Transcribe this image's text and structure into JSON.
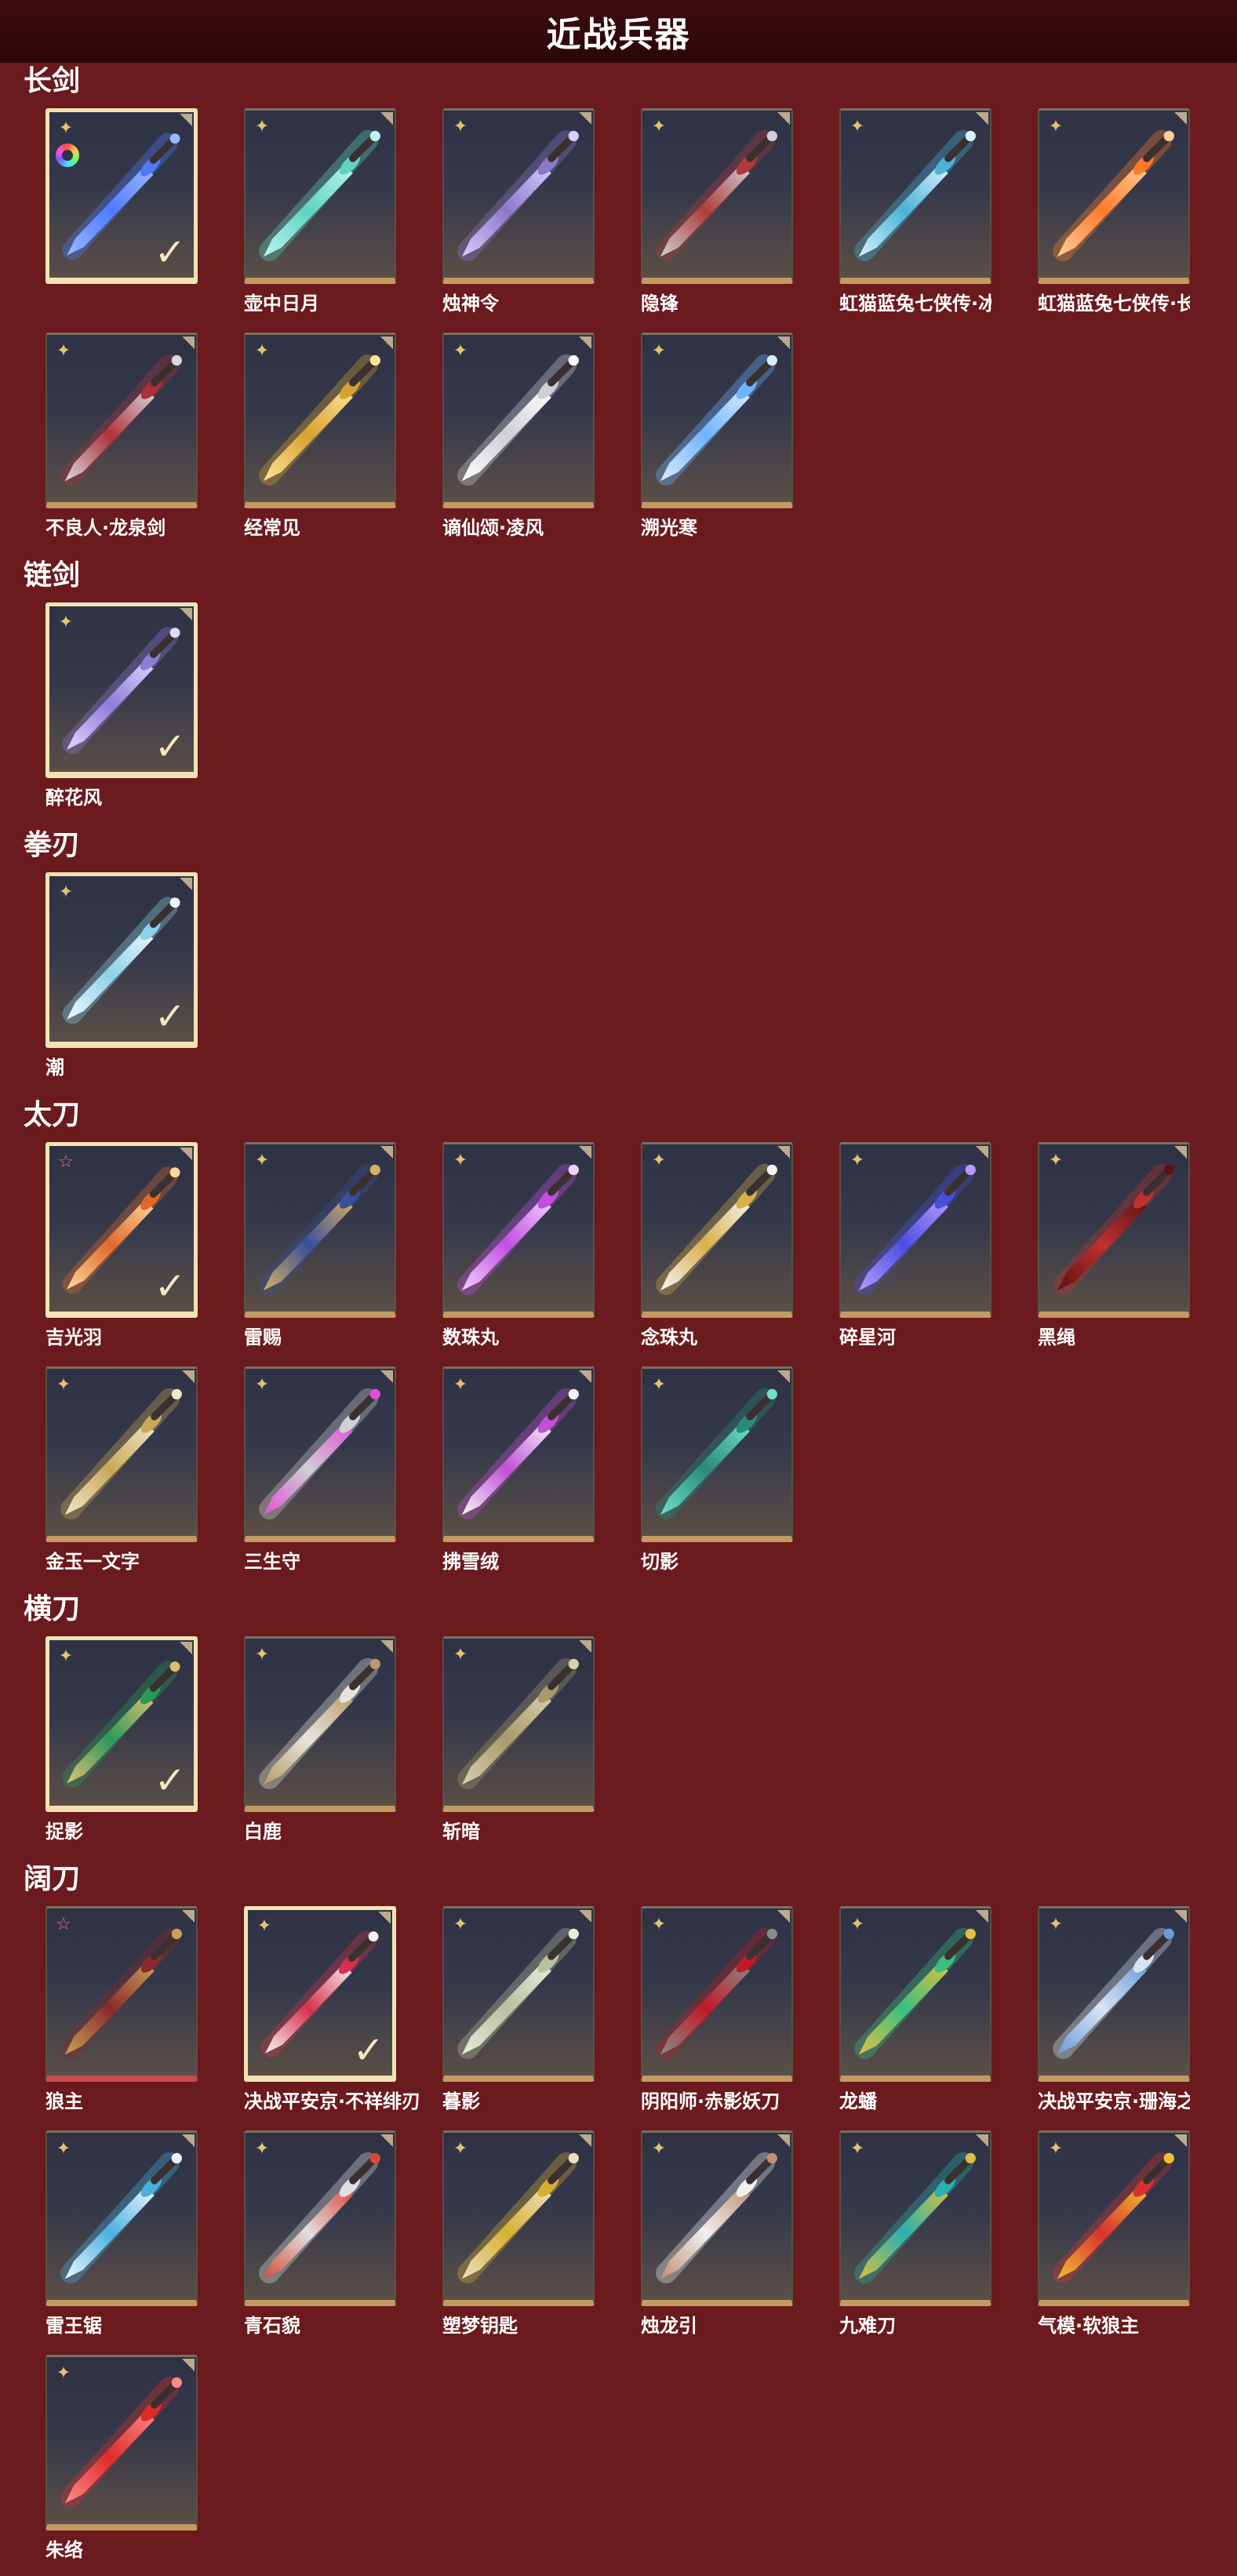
{
  "page": {
    "title": "近战兵器"
  },
  "sections": [
    {
      "title": "长剑",
      "items": [
        {
          "name": "",
          "badge": "gold",
          "dye": true,
          "owned": true,
          "color": "#4f7bff",
          "glow": "#9ab8ff"
        },
        {
          "name": "壶中日月",
          "badge": "gold",
          "color": "#5fd3c2",
          "glow": "#b8f5ec"
        },
        {
          "name": "烛神令",
          "badge": "gold",
          "color": "#8b78c9",
          "glow": "#d8ccff"
        },
        {
          "name": "隐锋",
          "badge": "gold",
          "color": "#b03a3a",
          "glow": "#cfcfd8"
        },
        {
          "name": "虹猫蓝兔七侠传·冰魄剑",
          "badge": "gold",
          "color": "#4bb3d6",
          "glow": "#d6f3ff"
        },
        {
          "name": "虹猫蓝兔七侠传·长虹剑",
          "badge": "gold",
          "color": "#ff7a2a",
          "glow": "#ffd09a"
        },
        {
          "name": "不良人·龙泉剑",
          "badge": "gold",
          "color": "#b0303a",
          "glow": "#d8d8e0"
        },
        {
          "name": "经常见",
          "badge": "gold",
          "color": "#d6a230",
          "glow": "#ffe39a"
        },
        {
          "name": "谪仙颂·凌风",
          "badge": "gold",
          "color": "#cfcfd4",
          "glow": "#ffffff"
        },
        {
          "name": "溯光寒",
          "badge": "gold",
          "color": "#6fb3ff",
          "glow": "#d9ecff"
        }
      ]
    },
    {
      "title": "链剑",
      "items": [
        {
          "name": "醉花风",
          "badge": "gold",
          "owned": true,
          "color": "#8f7bd8",
          "glow": "#e0d6ff"
        }
      ]
    },
    {
      "title": "拳刃",
      "items": [
        {
          "name": "潮",
          "badge": "gold",
          "owned": true,
          "color": "#8fd0e8",
          "glow": "#eef8ff"
        }
      ]
    },
    {
      "title": "太刀",
      "items": [
        {
          "name": "吉光羽",
          "badge": "pink",
          "owned": true,
          "color": "#e0692a",
          "glow": "#ffd6a0"
        },
        {
          "name": "雷赐",
          "badge": "gold",
          "color": "#3a4f9a",
          "glow": "#d6b060"
        },
        {
          "name": "数珠丸",
          "badge": "gold",
          "color": "#c24fe0",
          "glow": "#f0d0ff"
        },
        {
          "name": "念珠丸",
          "badge": "gold",
          "color": "#d8b04a",
          "glow": "#f4f4f4"
        },
        {
          "name": "碎星河",
          "badge": "gold",
          "color": "#4a4fe0",
          "glow": "#b89aff"
        },
        {
          "name": "黑绳",
          "badge": "gold",
          "color": "#c0302f",
          "glow": "#5a1414"
        },
        {
          "name": "金玉一文字",
          "badge": "gold",
          "color": "#c9a85a",
          "glow": "#f0e6c8"
        },
        {
          "name": "三生守",
          "badge": "gold",
          "color": "#cfcfd4",
          "glow": "#e04fd8"
        },
        {
          "name": "拂雪绒",
          "badge": "gold",
          "color": "#c24fd8",
          "glow": "#f4f4f4"
        },
        {
          "name": "切影",
          "badge": "gold",
          "color": "#2a8a7a",
          "glow": "#6fe0c8"
        }
      ]
    },
    {
      "title": "横刀",
      "items": [
        {
          "name": "捉影",
          "badge": "gold",
          "owned": true,
          "color": "#2a9a5a",
          "glow": "#e0c070"
        },
        {
          "name": "白鹿",
          "badge": "gold",
          "color": "#e8e4dc",
          "glow": "#b89a6a"
        },
        {
          "name": "斩暗",
          "badge": "gold",
          "color": "#a89a6a",
          "glow": "#d8d0b0"
        }
      ]
    },
    {
      "title": "阔刀",
      "items": [
        {
          "name": "狼主",
          "badge": "pink",
          "redBottom": true,
          "color": "#8a2a2a",
          "glow": "#c9a05a"
        },
        {
          "name": "决战平安京·不祥绯刃",
          "badge": "gold",
          "owned": true,
          "color": "#d8304a",
          "glow": "#f4f4f4"
        },
        {
          "name": "暮影",
          "badge": "gold",
          "color": "#b8c0a0",
          "glow": "#e8ecd8"
        },
        {
          "name": "阴阳师·赤影妖刀",
          "badge": "gold",
          "color": "#c01a24",
          "glow": "#8a8a8a"
        },
        {
          "name": "龙蟠",
          "badge": "gold",
          "color": "#3ac080",
          "glow": "#e0c040"
        },
        {
          "name": "决战平安京·珊海之刃",
          "badge": "gold",
          "color": "#d8e4f4",
          "glow": "#6a9ad8"
        },
        {
          "name": "雷王锯",
          "badge": "gold",
          "color": "#4ab0e0",
          "glow": "#f0f6ff"
        },
        {
          "name": "青石貌",
          "badge": "gold",
          "color": "#e0e0e0",
          "glow": "#d84a3a"
        },
        {
          "name": "塑梦钥匙",
          "badge": "gold",
          "color": "#d8b030",
          "glow": "#e8e0c0"
        },
        {
          "name": "烛龙引",
          "badge": "gold",
          "color": "#f0f0f0",
          "glow": "#c09070"
        },
        {
          "name": "九难刀",
          "badge": "gold",
          "color": "#2ab0b0",
          "glow": "#d8c040"
        },
        {
          "name": "气模·软狼主",
          "badge": "gold",
          "color": "#d83030",
          "glow": "#f0c030"
        },
        {
          "name": "朱络",
          "badge": "gold",
          "color": "#e02a2a",
          "glow": "#ff8a8a"
        }
      ]
    }
  ]
}
